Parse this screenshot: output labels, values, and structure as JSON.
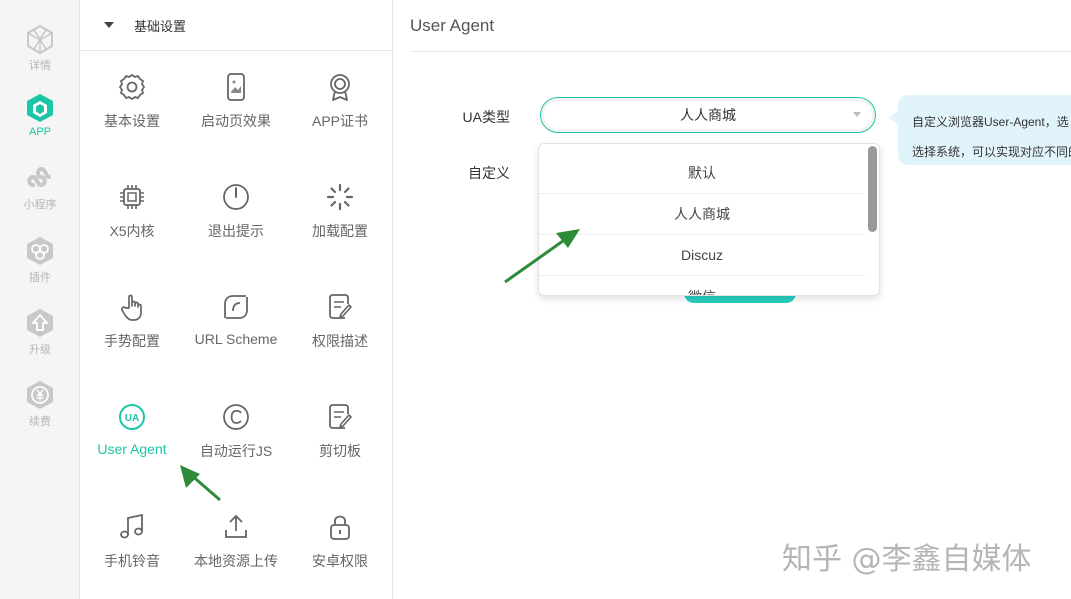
{
  "rail": {
    "items": [
      {
        "label": "详情",
        "icon": "cube-outline-icon",
        "active": false
      },
      {
        "label": "APP",
        "icon": "cube-solid-icon",
        "active": true
      },
      {
        "label": "小程序",
        "icon": "mini-program-icon",
        "active": false
      },
      {
        "label": "插件",
        "icon": "plugin-icon",
        "active": false
      },
      {
        "label": "升级",
        "icon": "upgrade-icon",
        "active": false
      },
      {
        "label": "续费",
        "icon": "renew-icon",
        "active": false
      }
    ]
  },
  "menu": {
    "section_title": "基础设置",
    "tiles": [
      {
        "label": "基本设置",
        "icon": "gear-icon"
      },
      {
        "label": "启动页效果",
        "icon": "splash-image-icon"
      },
      {
        "label": "APP证书",
        "icon": "certificate-icon"
      },
      {
        "label": "X5内核",
        "icon": "chip-icon"
      },
      {
        "label": "退出提示",
        "icon": "power-icon"
      },
      {
        "label": "加载配置",
        "icon": "loading-spinner-icon"
      },
      {
        "label": "手势配置",
        "icon": "hand-pointer-icon"
      },
      {
        "label": "URL Scheme",
        "icon": "url-scheme-icon"
      },
      {
        "label": "权限描述",
        "icon": "permission-doc-icon"
      },
      {
        "label": "User Agent",
        "icon": "ua-icon",
        "active": true
      },
      {
        "label": "自动运行JS",
        "icon": "copyright-c-icon"
      },
      {
        "label": "剪切板",
        "icon": "clipboard-doc-icon"
      },
      {
        "label": "手机铃音",
        "icon": "music-note-icon"
      },
      {
        "label": "本地资源上传",
        "icon": "upload-icon"
      },
      {
        "label": "安卓权限",
        "icon": "lock-icon"
      }
    ]
  },
  "main": {
    "title": "User Agent",
    "ua_type_label": "UA类型",
    "custom_label": "自定义",
    "ua_select_value": "人人商城",
    "dropdown_options": [
      "默认",
      "人人商城",
      "Discuz",
      "微信"
    ],
    "tooltip_line1": "自定义浏览器User-Agent，选",
    "tooltip_line2": "选择系统，可以实现对应不同的"
  },
  "watermark": "知乎 @李鑫自媒体",
  "colors": {
    "accent": "#1cc5a6",
    "tooltip_bg": "#e2f4fb",
    "annotation_arrow": "#2e8b3a"
  }
}
